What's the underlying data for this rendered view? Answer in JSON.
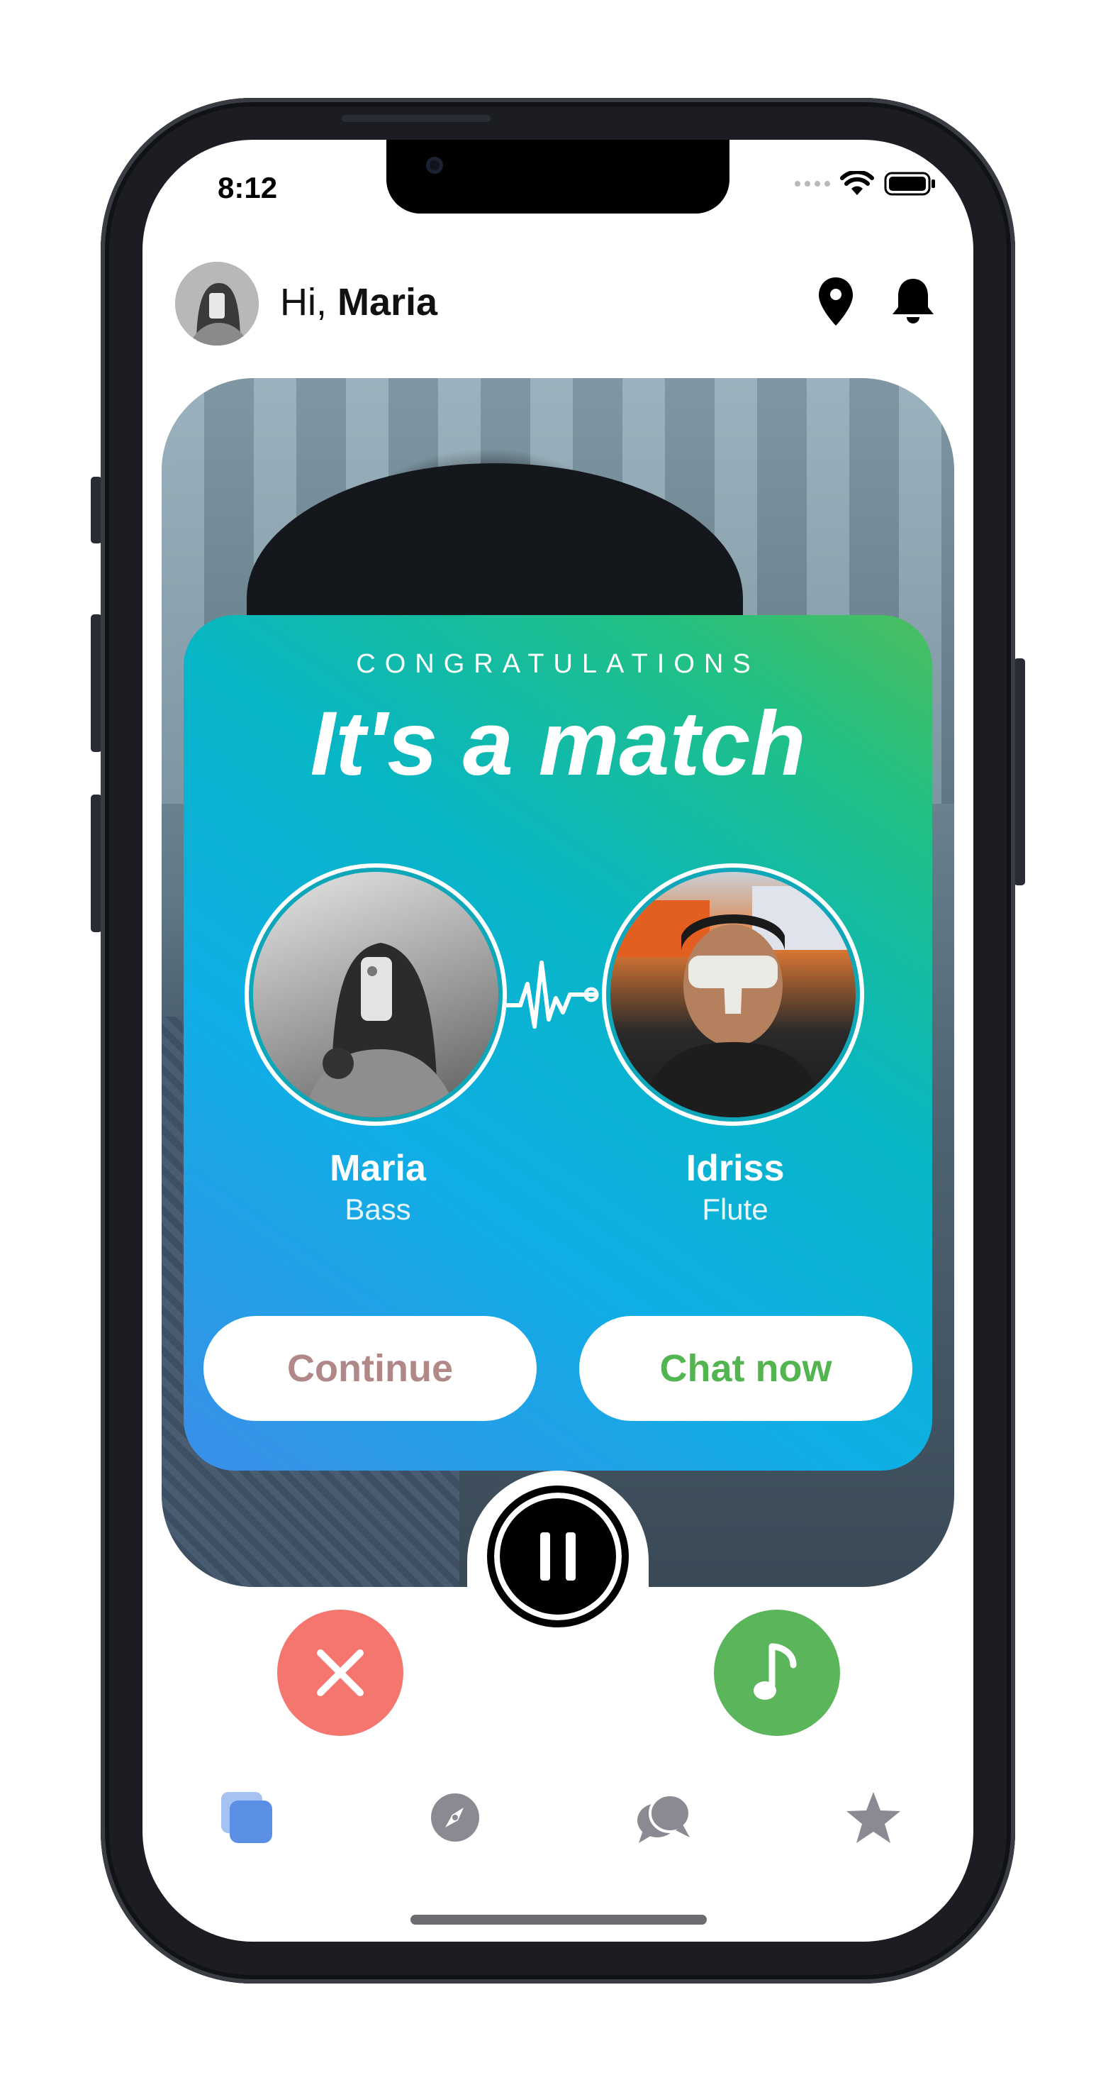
{
  "status_bar": {
    "time": "8:12",
    "icons": [
      "signal-dots-icon",
      "wifi-icon",
      "battery-icon"
    ]
  },
  "header": {
    "greeting_prefix": "Hi, ",
    "user_name": "Maria",
    "icons": [
      "location-pin-icon",
      "bell-icon"
    ]
  },
  "match_card": {
    "subtitle": "CONGRATULATIONS",
    "title": "It's a match",
    "people": [
      {
        "name": "Maria",
        "instrument": "Bass"
      },
      {
        "name": "Idriss",
        "instrument": "Flute"
      }
    ],
    "continue_label": "Continue",
    "chat_label": "Chat now"
  },
  "controls": {
    "play_state_icon": "pause-icon",
    "dislike_icon": "close-icon",
    "like_icon": "music-note-icon"
  },
  "tabbar": {
    "tabs": [
      {
        "icon": "cards-icon",
        "active": true
      },
      {
        "icon": "compass-icon",
        "active": false
      },
      {
        "icon": "chat-bubbles-icon",
        "active": false
      },
      {
        "icon": "star-icon",
        "active": false
      }
    ]
  },
  "colors": {
    "card_gradient_start": "#3a8fe8",
    "card_gradient_end": "#4cbd5e",
    "continue_text": "#b08888",
    "chat_text": "#53b550",
    "dislike": "#f4766f",
    "like": "#5bb55a",
    "active_tab": "#5b8fe6",
    "inactive_tab": "#8a8a92"
  }
}
